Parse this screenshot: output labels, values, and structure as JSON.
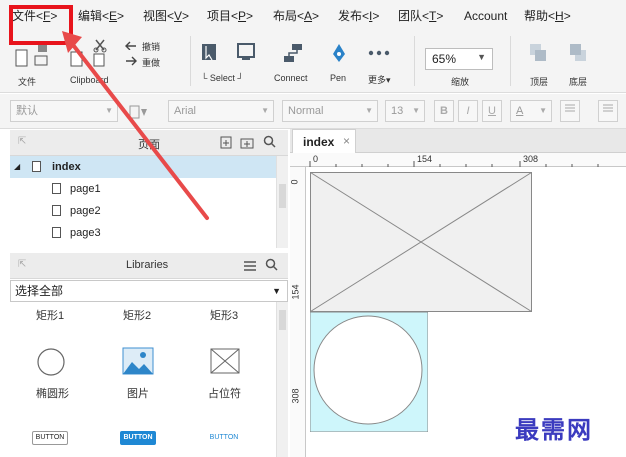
{
  "menubar": {
    "items": [
      {
        "label": "文件",
        "key": "F"
      },
      {
        "label": "编辑",
        "key": "E"
      },
      {
        "label": "视图",
        "key": "V"
      },
      {
        "label": "项目",
        "key": "P"
      },
      {
        "label": "布局",
        "key": "A"
      },
      {
        "label": "发布",
        "key": "I"
      },
      {
        "label": "团队",
        "key": "T"
      },
      {
        "label": "Account",
        "key": ""
      },
      {
        "label": "帮助",
        "key": "H"
      }
    ]
  },
  "toolbar": {
    "file_label": "文件",
    "clipboard_label": "Clipboard",
    "undo_label": "撤销",
    "redo_label": "重做",
    "select_label": "Select",
    "connect_label": "Connect",
    "pen_label": "Pen",
    "more_label": "更多▾",
    "zoom_value": "65%",
    "zoom_label": "缩放",
    "top_label": "顶层",
    "bottom_label": "底层"
  },
  "formatbar": {
    "style_value": "默认",
    "font_value": "Arial",
    "weight_value": "Normal",
    "size_value": "13",
    "bold": "B",
    "italic": "I",
    "underline": "U",
    "color": "A"
  },
  "pages_panel": {
    "title": "页面",
    "root": "index",
    "children": [
      "page1",
      "page2",
      "page3"
    ]
  },
  "libraries_panel": {
    "title": "Libraries",
    "select_value": "选择全部",
    "items_row1": [
      "矩形1",
      "矩形2",
      "矩形3"
    ],
    "items_row2": [
      "椭圆形",
      "图片",
      "占位符"
    ],
    "buttons_row": [
      "BUTTON",
      "BUTTON",
      "BUTTON"
    ]
  },
  "canvas": {
    "tab_label": "index",
    "ruler_h": [
      "0",
      "154",
      "308"
    ],
    "ruler_v": [
      "0",
      "154",
      "308"
    ]
  },
  "watermark": "最需网",
  "colors": {
    "highlight_box": "#e8141c",
    "arrow": "#e84a4a",
    "selection": "#cfe6f4",
    "image_fill": "#cef6fb",
    "watermark": "#3b3bbf"
  }
}
